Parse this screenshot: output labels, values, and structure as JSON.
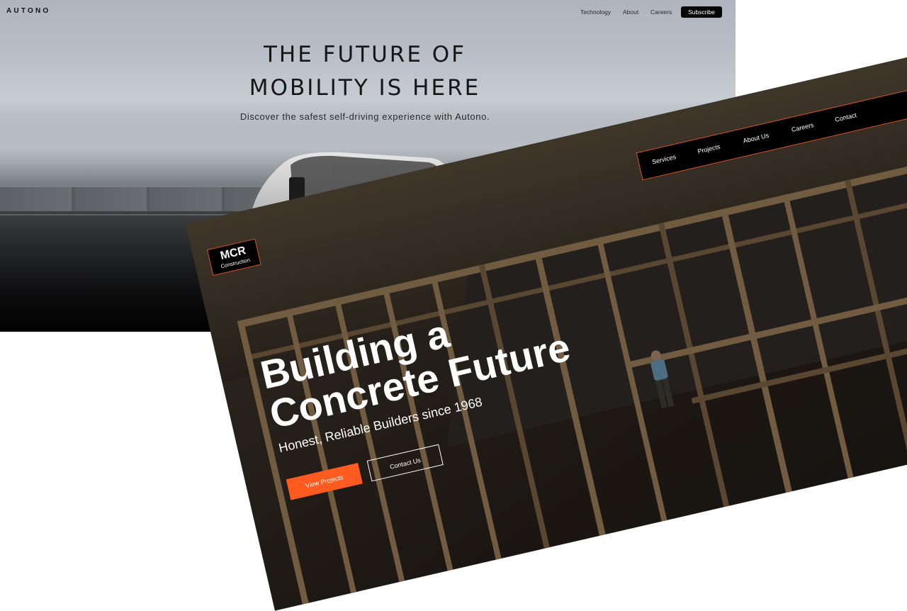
{
  "autono": {
    "logo": "AUTONO",
    "nav": [
      "Technology",
      "About",
      "Careers"
    ],
    "subscribe_label": "Subscribe",
    "headline_line1": "THE FUTURE OF",
    "headline_line2": "MOBILITY IS HERE",
    "tagline": "Discover the safest self-driving experience with Autono."
  },
  "mcr": {
    "logo_main": "MCR",
    "logo_sub": "Construction",
    "nav": [
      "Services",
      "Projects",
      "About Us",
      "Careers",
      "Contact"
    ],
    "headline_line1": "Building a",
    "headline_line2": "Concrete Future",
    "tagline": "Honest, Reliable Builders since 1968",
    "primary_button": "View Projects",
    "secondary_button": "Contact Us"
  },
  "colors": {
    "mcr_accent": "#ff5a1f",
    "autono_button": "#050505"
  }
}
